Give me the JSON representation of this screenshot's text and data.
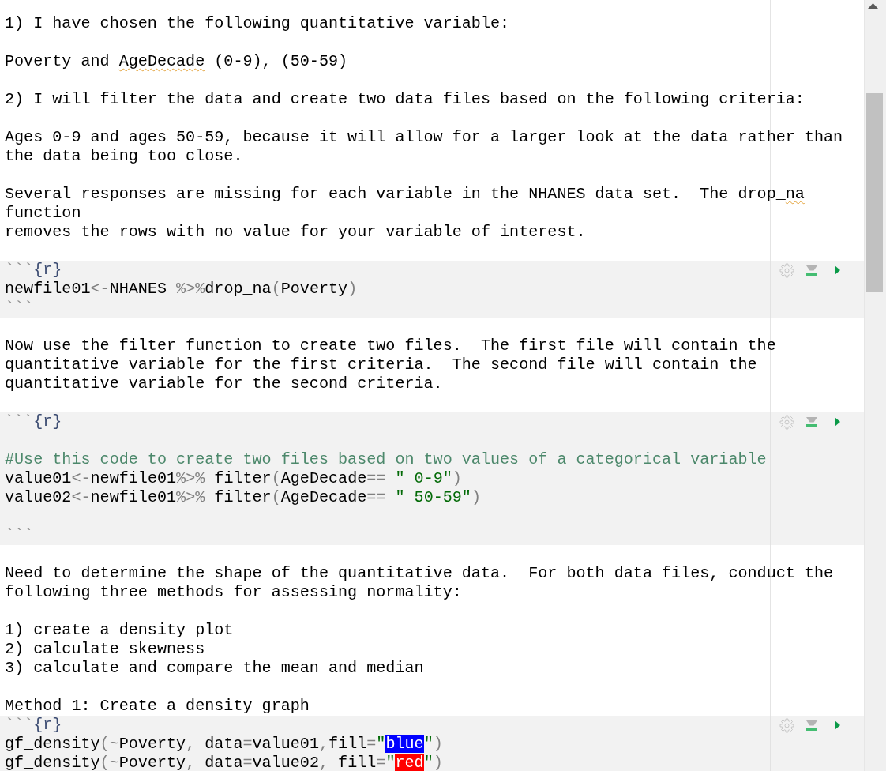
{
  "document": {
    "blocks": [
      {
        "kind": "prose",
        "lines": [
          {
            "kind": "text",
            "segments": [
              {
                "text": "1) I have chosen the following quantitative variable:",
                "kind": "plain"
              }
            ]
          },
          {
            "kind": "blank"
          },
          {
            "kind": "text",
            "segments": [
              {
                "text": "Poverty and ",
                "kind": "plain"
              },
              {
                "text": "AgeDecade",
                "kind": "spell"
              },
              {
                "text": " (0-9), (50-59)",
                "kind": "plain"
              }
            ]
          },
          {
            "kind": "blank"
          },
          {
            "kind": "text",
            "segments": [
              {
                "text": "2) I will filter the data and create two data files based on the following criteria:",
                "kind": "plain"
              }
            ]
          },
          {
            "kind": "blank"
          },
          {
            "kind": "text",
            "segments": [
              {
                "text": "Ages 0-9 and ages 50-59, because it will allow for a larger look at the data rather than",
                "kind": "plain"
              }
            ]
          },
          {
            "kind": "text",
            "segments": [
              {
                "text": "the data being too close.",
                "kind": "plain"
              }
            ]
          },
          {
            "kind": "blank"
          },
          {
            "kind": "text",
            "segments": [
              {
                "text": "Several responses are missing for each variable in the NHANES data set.  The drop_",
                "kind": "plain"
              },
              {
                "text": "na",
                "kind": "spell"
              }
            ]
          },
          {
            "kind": "text",
            "segments": [
              {
                "text": "function",
                "kind": "plain"
              }
            ]
          },
          {
            "kind": "text",
            "segments": [
              {
                "text": "removes the rows with no value for your variable of interest.",
                "kind": "plain"
              }
            ]
          },
          {
            "kind": "blank"
          }
        ]
      },
      {
        "kind": "chunk",
        "lines": [
          {
            "kind": "header",
            "segments": [
              {
                "text": "```",
                "kind": "fence"
              },
              {
                "text": "{r}",
                "kind": "lang"
              }
            ]
          },
          {
            "kind": "code",
            "segments": [
              {
                "text": "newfile01",
                "kind": "plain"
              },
              {
                "text": "<-",
                "kind": "op"
              },
              {
                "text": "NHANES ",
                "kind": "plain"
              },
              {
                "text": "%>%",
                "kind": "op"
              },
              {
                "text": "drop_na",
                "kind": "plain"
              },
              {
                "text": "(",
                "kind": "op"
              },
              {
                "text": "Poverty",
                "kind": "plain"
              },
              {
                "text": ")",
                "kind": "op"
              }
            ]
          },
          {
            "kind": "fence",
            "segments": [
              {
                "text": "```",
                "kind": "fence"
              }
            ]
          }
        ]
      },
      {
        "kind": "prose",
        "lines": [
          {
            "kind": "blank"
          },
          {
            "kind": "text",
            "segments": [
              {
                "text": "Now use the filter function to create two files.  The first file will contain the",
                "kind": "plain"
              }
            ]
          },
          {
            "kind": "text",
            "segments": [
              {
                "text": "quantitative variable for the first criteria.  The second file will contain the",
                "kind": "plain"
              }
            ]
          },
          {
            "kind": "text",
            "segments": [
              {
                "text": "quantitative variable for the second criteria.",
                "kind": "plain"
              }
            ]
          },
          {
            "kind": "blank"
          }
        ]
      },
      {
        "kind": "chunk",
        "lines": [
          {
            "kind": "header",
            "segments": [
              {
                "text": "```",
                "kind": "fence"
              },
              {
                "text": "{r}",
                "kind": "lang"
              }
            ]
          },
          {
            "kind": "blank"
          },
          {
            "kind": "comment",
            "segments": [
              {
                "text": "#Use this code to create two files based on two values of a categorical variable",
                "kind": "comment"
              }
            ]
          },
          {
            "kind": "code",
            "segments": [
              {
                "text": "value01",
                "kind": "plain"
              },
              {
                "text": "<-",
                "kind": "op"
              },
              {
                "text": "newfile01",
                "kind": "plain"
              },
              {
                "text": "%>%",
                "kind": "op"
              },
              {
                "text": " filter",
                "kind": "plain"
              },
              {
                "text": "(",
                "kind": "op"
              },
              {
                "text": "AgeDecade",
                "kind": "plain"
              },
              {
                "text": "==",
                "kind": "op"
              },
              {
                "text": " \" 0-9\"",
                "kind": "string"
              },
              {
                "text": ")",
                "kind": "op"
              }
            ]
          },
          {
            "kind": "code",
            "segments": [
              {
                "text": "value02",
                "kind": "plain"
              },
              {
                "text": "<-",
                "kind": "op"
              },
              {
                "text": "newfile01",
                "kind": "plain"
              },
              {
                "text": "%>%",
                "kind": "op"
              },
              {
                "text": " filter",
                "kind": "plain"
              },
              {
                "text": "(",
                "kind": "op"
              },
              {
                "text": "AgeDecade",
                "kind": "plain"
              },
              {
                "text": "==",
                "kind": "op"
              },
              {
                "text": " \" 50-59\"",
                "kind": "string"
              },
              {
                "text": ")",
                "kind": "op"
              }
            ]
          },
          {
            "kind": "blank"
          },
          {
            "kind": "fence",
            "segments": [
              {
                "text": "```",
                "kind": "fence"
              }
            ]
          }
        ]
      },
      {
        "kind": "prose",
        "lines": [
          {
            "kind": "blank"
          },
          {
            "kind": "text",
            "segments": [
              {
                "text": "Need to determine the shape of the quantitative data.  For both data files, conduct the",
                "kind": "plain"
              }
            ]
          },
          {
            "kind": "text",
            "segments": [
              {
                "text": "following three methods for assessing normality:",
                "kind": "plain"
              }
            ]
          },
          {
            "kind": "blank"
          },
          {
            "kind": "text",
            "segments": [
              {
                "text": "1) create a density plot",
                "kind": "plain"
              }
            ]
          },
          {
            "kind": "text",
            "segments": [
              {
                "text": "2) calculate skewness",
                "kind": "plain"
              }
            ]
          },
          {
            "kind": "text",
            "segments": [
              {
                "text": "3) calculate and compare the mean and median",
                "kind": "plain"
              }
            ]
          },
          {
            "kind": "blank"
          },
          {
            "kind": "text",
            "segments": [
              {
                "text": "Method 1: Create a density graph",
                "kind": "plain"
              }
            ]
          }
        ]
      },
      {
        "kind": "chunk",
        "lines": [
          {
            "kind": "header",
            "segments": [
              {
                "text": "```",
                "kind": "fence"
              },
              {
                "text": "{r}",
                "kind": "lang"
              }
            ]
          },
          {
            "kind": "code",
            "segments": [
              {
                "text": "gf_density",
                "kind": "plain"
              },
              {
                "text": "(",
                "kind": "op"
              },
              {
                "text": "~",
                "kind": "op"
              },
              {
                "text": "Poverty",
                "kind": "plain"
              },
              {
                "text": ",",
                "kind": "op"
              },
              {
                "text": " data",
                "kind": "plain"
              },
              {
                "text": "=",
                "kind": "op"
              },
              {
                "text": "value01",
                "kind": "plain"
              },
              {
                "text": ",",
                "kind": "op"
              },
              {
                "text": "fill",
                "kind": "plain"
              },
              {
                "text": "=",
                "kind": "op"
              },
              {
                "text": "\"",
                "kind": "string"
              },
              {
                "text": "blue",
                "kind": "swatch",
                "color": "#0000ff"
              },
              {
                "text": "\"",
                "kind": "string"
              },
              {
                "text": ")",
                "kind": "op"
              }
            ]
          },
          {
            "kind": "code",
            "segments": [
              {
                "text": "gf_density",
                "kind": "plain"
              },
              {
                "text": "(",
                "kind": "op"
              },
              {
                "text": "~",
                "kind": "op"
              },
              {
                "text": "Poverty",
                "kind": "plain"
              },
              {
                "text": ",",
                "kind": "op"
              },
              {
                "text": " data",
                "kind": "plain"
              },
              {
                "text": "=",
                "kind": "op"
              },
              {
                "text": "value02",
                "kind": "plain"
              },
              {
                "text": ",",
                "kind": "op"
              },
              {
                "text": " fill",
                "kind": "plain"
              },
              {
                "text": "=",
                "kind": "op"
              },
              {
                "text": "\"",
                "kind": "string"
              },
              {
                "text": "red",
                "kind": "swatch",
                "color": "#ff0000"
              },
              {
                "text": "\"",
                "kind": "string"
              },
              {
                "text": ")",
                "kind": "op"
              }
            ]
          }
        ]
      }
    ]
  }
}
